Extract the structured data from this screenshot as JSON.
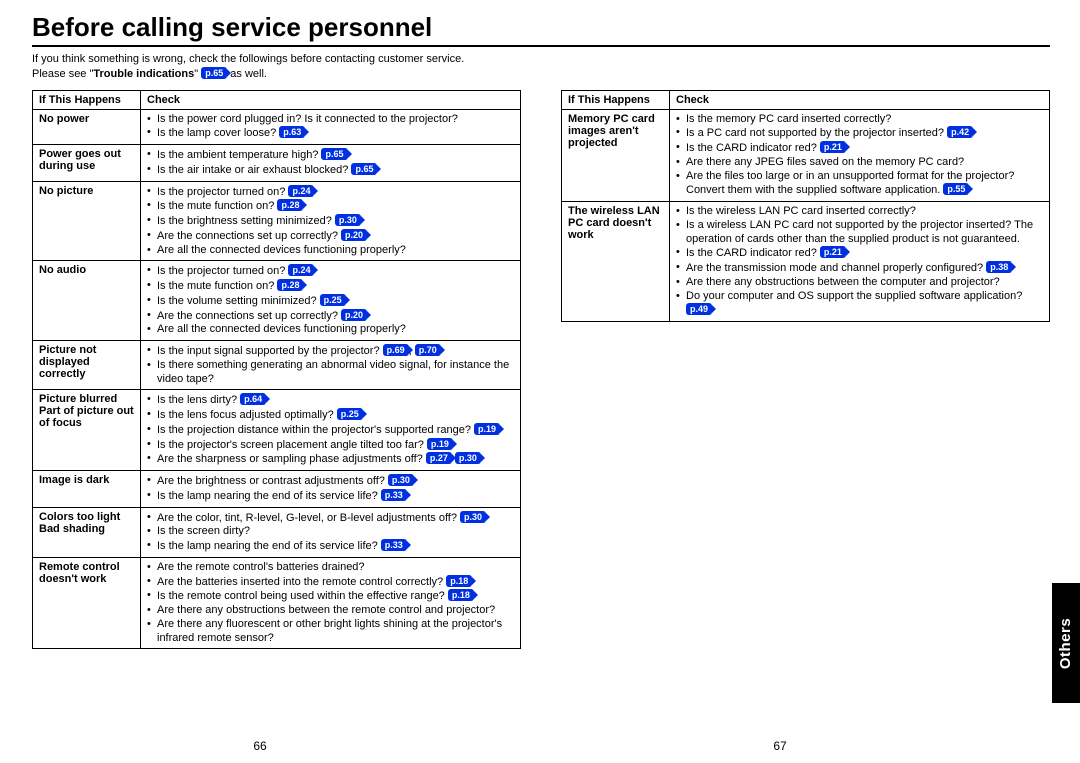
{
  "title": "Before calling service personnel",
  "intro_line1": "If you think something is wrong, check the followings before contacting customer service.",
  "intro_line2_a": "Please see \"",
  "intro_line2_b": "Trouble indications",
  "intro_line2_c": "\" ",
  "intro_line2_d": " as well.",
  "intro_pref": "p.65",
  "headers": {
    "symptom": "If  This Happens",
    "check": "Check"
  },
  "side_tab": "Others",
  "page_left": "66",
  "page_right": "67",
  "left_rows": [
    {
      "symptom": "No power",
      "items": [
        {
          "text": "Is the power cord plugged in? Is it connected to the projector?"
        },
        {
          "text": "Is the lamp cover loose? ",
          "refs": [
            "p.63"
          ]
        }
      ]
    },
    {
      "symptom": "Power goes out during use",
      "items": [
        {
          "text": "Is the ambient temperature high? ",
          "refs": [
            "p.65"
          ]
        },
        {
          "text": "Is the air intake or air exhaust blocked? ",
          "refs": [
            "p.65"
          ]
        }
      ]
    },
    {
      "symptom": "No picture",
      "items": [
        {
          "text": "Is the projector turned on? ",
          "refs": [
            "p.24"
          ]
        },
        {
          "text": "Is the mute function on? ",
          "refs": [
            "p.28"
          ]
        },
        {
          "text": "Is the brightness setting minimized? ",
          "refs": [
            "p.30"
          ]
        },
        {
          "text": "Are the connections set up correctly? ",
          "refs": [
            "p.20"
          ]
        },
        {
          "text": "Are all the connected devices functioning properly?"
        }
      ]
    },
    {
      "symptom": "No audio",
      "items": [
        {
          "text": "Is the projector turned on? ",
          "refs": [
            "p.24"
          ]
        },
        {
          "text": "Is the mute function on? ",
          "refs": [
            "p.28"
          ]
        },
        {
          "text": "Is the volume setting minimized? ",
          "refs": [
            "p.25"
          ]
        },
        {
          "text": "Are the connections set up correctly? ",
          "refs": [
            "p.20"
          ]
        },
        {
          "text": "Are all the connected devices functioning properly?"
        }
      ]
    },
    {
      "symptom": "Picture not displayed correctly",
      "items": [
        {
          "text": "Is the input signal supported by the projector? ",
          "refs": [
            "p.69",
            "p.70"
          ],
          "sep": ", "
        },
        {
          "text": "Is there something generating an abnormal video signal, for instance the video tape?"
        }
      ]
    },
    {
      "symptom": "Picture blurred Part of picture out of focus",
      "items": [
        {
          "text": "Is the lens dirty? ",
          "refs": [
            "p.64"
          ]
        },
        {
          "text": "Is the lens focus adjusted optimally? ",
          "refs": [
            "p.25"
          ]
        },
        {
          "text": "Is the projection distance within the projector's supported range? ",
          "refs": [
            "p.19"
          ]
        },
        {
          "text": "Is the projector's screen placement angle tilted too far? ",
          "refs": [
            "p.19"
          ]
        },
        {
          "text": "Are the sharpness or sampling phase adjustments off? ",
          "refs": [
            "p.27",
            "p.30"
          ]
        }
      ]
    },
    {
      "symptom": "Image is dark",
      "items": [
        {
          "text": "Are the brightness or contrast adjustments off? ",
          "refs": [
            "p.30"
          ]
        },
        {
          "text": "Is the lamp nearing the end of its service life? ",
          "refs": [
            "p.33"
          ]
        }
      ]
    },
    {
      "symptom": "Colors too light Bad shading",
      "items": [
        {
          "text": "Are the color, tint, R-level, G-level, or B-level adjustments off? ",
          "refs": [
            "p.30"
          ]
        },
        {
          "text": "Is the screen dirty?"
        },
        {
          "text": "Is the lamp nearing the end of its service life? ",
          "refs": [
            "p.33"
          ]
        }
      ]
    },
    {
      "symptom": "Remote control doesn't work",
      "items": [
        {
          "text": "Are the remote control's batteries drained?"
        },
        {
          "text": "Are the batteries inserted into the remote control correctly? ",
          "refs": [
            "p.18"
          ]
        },
        {
          "text": "Is the remote control being used within the effective range? ",
          "refs": [
            "p.18"
          ]
        },
        {
          "text": "Are there any obstructions between the remote control and projector?"
        },
        {
          "text": "Are there any fluorescent or other bright lights shining at the projector's infrared remote sensor?"
        }
      ]
    }
  ],
  "right_rows": [
    {
      "symptom": "Memory PC card images aren't projected",
      "items": [
        {
          "text": "Is the memory PC card inserted correctly?"
        },
        {
          "text": "Is a PC card not supported by the projector inserted? ",
          "refs": [
            "p.42"
          ]
        },
        {
          "text": "Is the CARD indicator red? ",
          "refs": [
            "p.21"
          ]
        },
        {
          "text": "Are there any JPEG files saved on the memory PC card?"
        },
        {
          "text": "Are the files too large or in an unsupported format for the projector? Convert them with the supplied software application. ",
          "refs": [
            "p.55"
          ]
        }
      ]
    },
    {
      "symptom": "The wireless LAN PC card doesn't work",
      "items": [
        {
          "text": "Is the wireless LAN PC card inserted correctly?"
        },
        {
          "text": "Is a wireless LAN PC card not supported by the projector inserted? The operation of cards other than the supplied product is not guaranteed."
        },
        {
          "text": "Is the CARD indicator red? ",
          "refs": [
            "p.21"
          ]
        },
        {
          "text": "Are the transmission mode and channel properly configured? ",
          "refs": [
            "p.38"
          ]
        },
        {
          "text": "Are there any obstructions between the computer and projector?"
        },
        {
          "text": "Do your computer and OS support the supplied software application? ",
          "refs": [
            "p.49"
          ]
        }
      ]
    }
  ]
}
